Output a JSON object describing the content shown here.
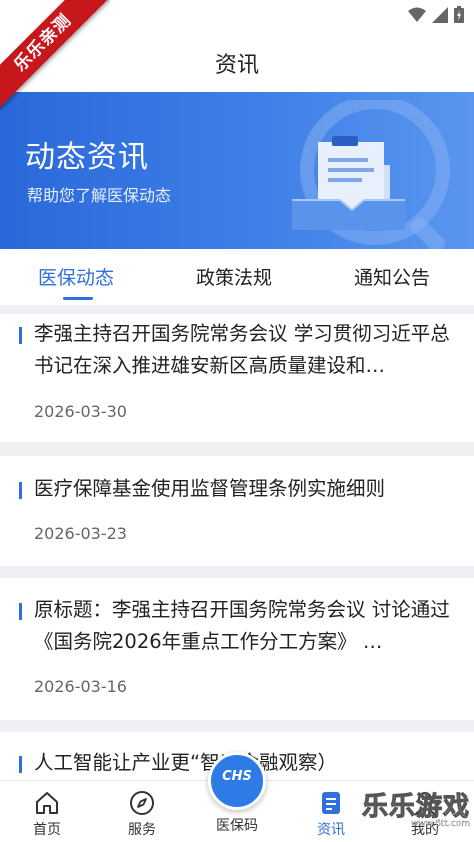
{
  "watermark": {
    "ribbon": "乐乐亲测",
    "corner_main": "乐乐游戏",
    "corner_url": "www.6tt.com"
  },
  "header": {
    "title": "资讯"
  },
  "banner": {
    "title": "动态资讯",
    "subtitle": "帮助您了解医保动态"
  },
  "tabs": [
    {
      "label": "医保动态",
      "active": true
    },
    {
      "label": "政策法规",
      "active": false
    },
    {
      "label": "通知公告",
      "active": false
    }
  ],
  "news": [
    {
      "title": "李强主持召开国务院常务会议 学习贯彻习近平总书记在深入推进雄安新区高质量建设和…",
      "date": "2026-03-30"
    },
    {
      "title": "医疗保障基金使用监督管理条例实施细则",
      "date": "2026-03-23"
    },
    {
      "title": "原标题：李强主持召开国务院常务会议 讨论通过《国务院2026年重点工作分工方案》 …",
      "date": "2026-03-16"
    },
    {
      "title": "人工智能让产业更“智”（金融观察）",
      "date": ""
    }
  ],
  "bottom_nav": [
    {
      "label": "首页",
      "icon": "home-icon"
    },
    {
      "label": "服务",
      "icon": "compass-icon"
    },
    {
      "label": "医保码",
      "icon": "chs-code-icon"
    },
    {
      "label": "资讯",
      "icon": "news-icon",
      "active": true
    },
    {
      "label": "我的",
      "icon": "user-icon"
    }
  ],
  "center_button": {
    "text": "CHS"
  },
  "colors": {
    "accent": "#2f6fe0",
    "banner": "#3a7ae6"
  }
}
